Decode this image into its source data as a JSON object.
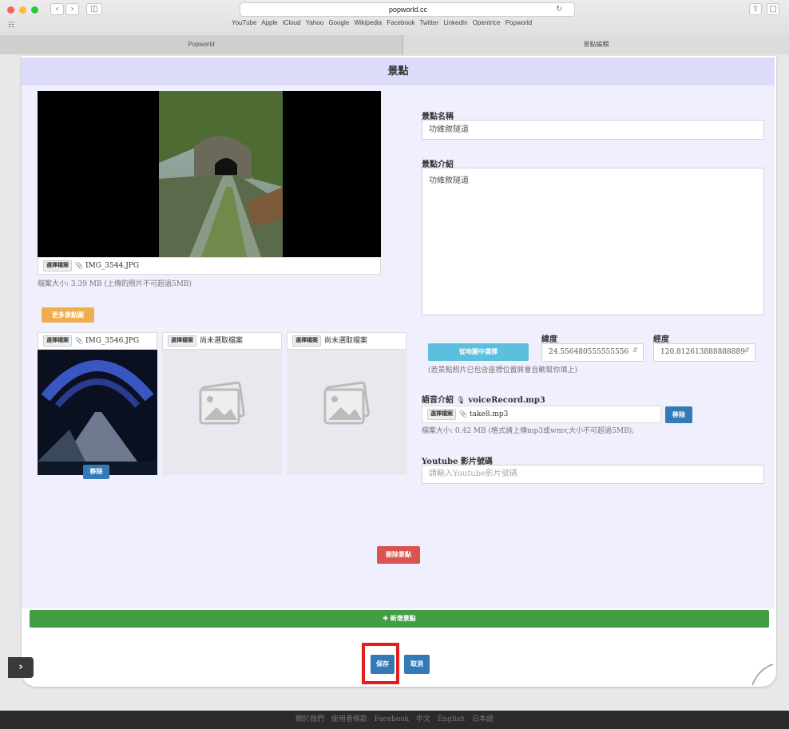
{
  "browser": {
    "url": "popworld.cc",
    "favorites": "YouTube  Apple  iCloud  Yahoo  Google  Wikipedia  Facebook  Twitter  LinkedIn  Opentrice  Popworld",
    "tabs": [
      "Popworld",
      "景點編輯"
    ]
  },
  "page": {
    "title": "景點"
  },
  "photo_upload": {
    "choose_label": "選擇檔案",
    "filename": "IMG_3544.JPG",
    "size_note": "檔案大小: 3.39 MB (上傳的照片不可超過5MB)"
  },
  "more_photos_button": "更多景點圖",
  "extra_photos": [
    {
      "choose_label": "選擇檔案",
      "filename": "IMG_3546.JPG",
      "remove_label": "移除"
    },
    {
      "choose_label": "選擇檔案",
      "filename": "尚未選取檔案"
    },
    {
      "choose_label": "選擇檔案",
      "filename": "尚未選取檔案"
    }
  ],
  "form": {
    "name_label": "景點名稱",
    "name_value": "功維敘隧道",
    "intro_label": "景點介紹",
    "intro_value": "功維敘隧道",
    "latitude_label": "緯度",
    "longitude_label": "經度",
    "map_button": "從地圖中選擇",
    "latitude_value": "24.556480555555556",
    "longitude_value": "120.812613888888889",
    "map_note": "(若景點照片已包含座標位置將會自動幫你填上)",
    "audio_label": "語音介紹",
    "audio_file": "voiceRecord.mp3",
    "audio_choose": "選擇檔案",
    "audio_filename": "take8.mp3",
    "audio_remove": "移除",
    "audio_note": "檔案大小: 0.42 MB (格式請上傳mp3或wmv,大小不可超過5MB);",
    "youtube_label": "Youtube 影片號碼",
    "youtube_placeholder": "請輸入Youtube影片號碼"
  },
  "delete_button": "刪除景點",
  "add_button": "新增景點",
  "save_button": "保存",
  "cancel_button": "取消",
  "footer": "關於我們  使用者條款  Facebook  中文  English  日本語",
  "colors": {
    "header": "#dcdcfa",
    "panel": "#efeffd",
    "highlight": "#e31e1e"
  }
}
